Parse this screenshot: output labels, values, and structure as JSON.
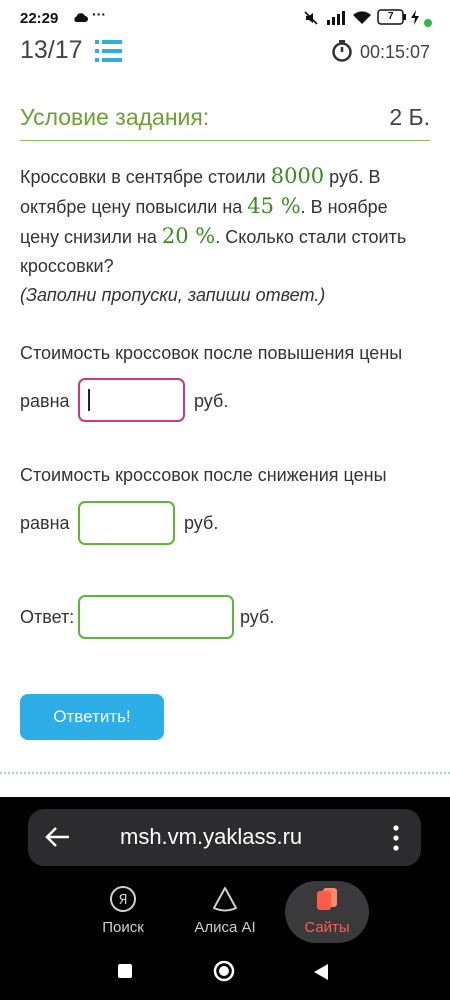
{
  "status_bar": {
    "time": "22:29",
    "battery": "7"
  },
  "header": {
    "progress": "13/17",
    "timer": "00:15:07"
  },
  "task": {
    "title": "Условие задания:",
    "points": "2 Б.",
    "text_parts": {
      "p1": "Кроссовки в сентябре стоили ",
      "n1": "8000",
      "p2": " руб. В октябре цену повысили на ",
      "n2": "45 %",
      "p3": ". В ноябре цену снизили на ",
      "n3": "20 %",
      "p4": ". Сколько стали стоить кроссовки?"
    },
    "hint": "(Заполни пропуски, запиши ответ.)"
  },
  "questions": {
    "q1_label": "Стоимость кроссовок после повышения цены",
    "q1_word": "равна",
    "q1_value": "",
    "q1_unit": "руб.",
    "q2_label": "Стоимость кроссовок после снижения цены",
    "q2_word": "равна",
    "q2_value": "",
    "q2_unit": "руб.",
    "answer_label": "Ответ:",
    "answer_value": "",
    "answer_unit": "руб."
  },
  "submit_label": "Ответить!",
  "browser": {
    "url": "msh.vm.yaklass.ru",
    "tabs": [
      {
        "label": "Поиск",
        "icon": "search-ya-icon"
      },
      {
        "label": "Алиса AI",
        "icon": "alice-icon"
      },
      {
        "label": "Сайты",
        "icon": "sites-icon"
      }
    ]
  },
  "colors": {
    "accent_green": "#6aa12f",
    "number_green": "#3b8a24",
    "field_border": "#5fb43a",
    "active_field_border": "#c6398a",
    "button_blue": "#2eaee7",
    "selected_tab_text": "#ff5a4e"
  }
}
